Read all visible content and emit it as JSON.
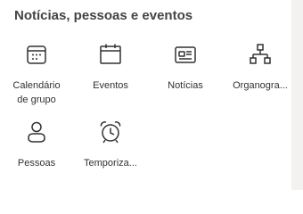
{
  "section": {
    "title": "Notícias, pessoas e eventos"
  },
  "tiles": [
    {
      "label": "Calendário de grupo",
      "icon": "group-calendar-icon"
    },
    {
      "label": "Eventos",
      "icon": "calendar-icon"
    },
    {
      "label": "Notícias",
      "icon": "news-icon"
    },
    {
      "label": "Organogra...",
      "icon": "org-chart-icon"
    },
    {
      "label": "Pessoas",
      "icon": "person-icon"
    },
    {
      "label": "Temporiza...",
      "icon": "alarm-clock-icon"
    }
  ],
  "colors": {
    "text": "#323130",
    "title": "#444444",
    "icon_stroke": "#323130",
    "rail": "#f3f2f1"
  }
}
